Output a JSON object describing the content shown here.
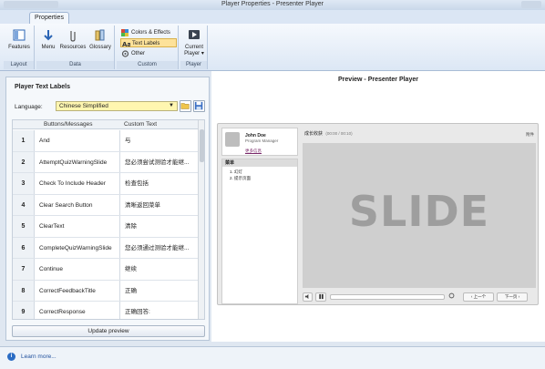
{
  "window": {
    "title": "Player Properties - Presenter Player"
  },
  "ribbon": {
    "tab": "Properties",
    "groups": {
      "layout": {
        "label": "Layout",
        "features": "Features"
      },
      "data": {
        "label": "Data",
        "menu": "Menu",
        "resources": "Resources",
        "glossary": "Glossary"
      },
      "custom": {
        "label": "Custom",
        "colors_effects": "Colors & Effects",
        "text_labels": "Text Labels",
        "other": "Other"
      },
      "player": {
        "label": "Player",
        "current_player_1": "Current",
        "current_player_2": "Player ▾"
      }
    }
  },
  "left_panel": {
    "title": "Player Text Labels",
    "language_label": "Language:",
    "language_value": "Chinese Simplified",
    "columns": [
      "Buttons/Messages",
      "Custom Text"
    ],
    "rows": [
      {
        "num": "1",
        "key": "And",
        "val": "与"
      },
      {
        "num": "2",
        "key": "AttemptQuizWarningSlide",
        "val": "您必须尝试测验才能继..."
      },
      {
        "num": "3",
        "key": "Check To Include Header",
        "val": "检查包括"
      },
      {
        "num": "4",
        "key": "Clear Search Button",
        "val": "清晰返回菜单"
      },
      {
        "num": "5",
        "key": "ClearText",
        "val": "清除"
      },
      {
        "num": "6",
        "key": "CompleteQuizWarningSlide",
        "val": "您必须通过测验才能继..."
      },
      {
        "num": "7",
        "key": "Continue",
        "val": "继续"
      },
      {
        "num": "8",
        "key": "CorrectFeedbackTitle",
        "val": "正确"
      },
      {
        "num": "9",
        "key": "CorrectResponse",
        "val": "正确回答:"
      }
    ],
    "update_button": "Update preview"
  },
  "preview": {
    "title": "Preview - Presenter Player",
    "profile": {
      "name": "John Doe",
      "role": "Program Manager",
      "link": "更多信息"
    },
    "outline": {
      "header": "菜单",
      "items": [
        "1. 幻灯",
        "2. 提示页面"
      ]
    },
    "slide": {
      "title": "成长收获",
      "time": "(00:00 / 00:10)",
      "right_label": "附件",
      "slide_text": "SLIDE"
    },
    "controls": {
      "prev": "‹ 上一个",
      "next": "下一页 ›"
    }
  },
  "statusbar": {
    "learn_more": "Learn more..."
  },
  "colors": {
    "active_label_bg": "#fde29a",
    "language_bg": "#fff6b0",
    "link": "#1f4f9c"
  }
}
